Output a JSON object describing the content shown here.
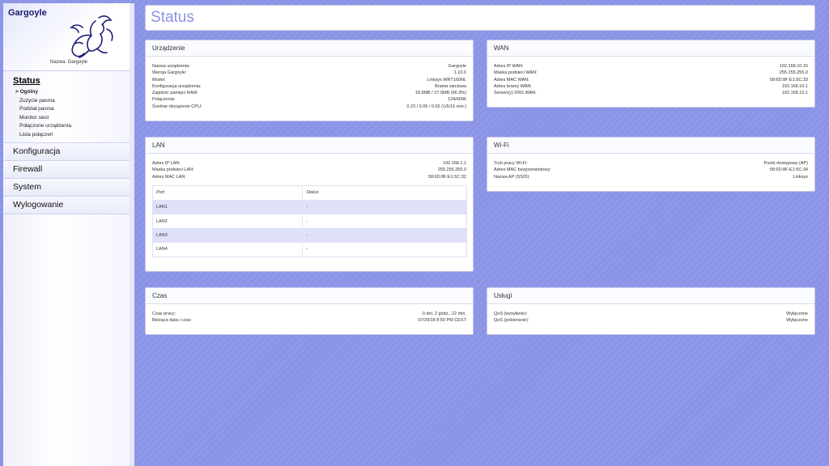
{
  "sidebar": {
    "title": "Gargoyle",
    "device_name": "Nazwa: Gargoyle",
    "current": {
      "label": "Status",
      "subitems": [
        "> Ogólny",
        "Zużycie pasma",
        "Podział pasma",
        "Monitor sieci",
        "Połączone urządzenia",
        "Lista połączeń"
      ]
    },
    "items": [
      "Konfiguracja",
      "Firewall",
      "System",
      "Wylogowanie"
    ]
  },
  "page_title": "Status",
  "device": {
    "title": "Urządzenie",
    "rows": [
      {
        "k": "Nazwa urządzenia:",
        "v": "Gargoyle"
      },
      {
        "k": "Wersja Gargoyle:",
        "v": "1.10.0"
      },
      {
        "k": "Model:",
        "v": "Linksys WRT160NL"
      },
      {
        "k": "Konfiguracja urządzenia:",
        "v": "Brama sieciowa"
      },
      {
        "k": "Zajętość pamięci RAM:",
        "v": "18.5MB / 27.9MB (66.3%)"
      },
      {
        "k": "Połączenia:",
        "v": "124/4096"
      },
      {
        "k": "Średnie obciążenie CPU:",
        "v": "0.23 / 0.05 / 0.02 (1/5/15 min.)"
      }
    ]
  },
  "wan": {
    "title": "WAN",
    "rows": [
      {
        "k": "Adres IP WAN:",
        "v": "192.168.10.15"
      },
      {
        "k": "Maska podsieci WAN:",
        "v": "255.255.255.0"
      },
      {
        "k": "Adres MAC WAN:",
        "v": "58:6D:8F:E1:5C:33"
      },
      {
        "k": "Adres bramy WAN:",
        "v": "192.168.10.1"
      },
      {
        "k": "Serwer(y) DNS WAN:",
        "v": "192.168.10.1"
      }
    ]
  },
  "lan": {
    "title": "LAN",
    "rows": [
      {
        "k": "Adres IP LAN:",
        "v": "192.168.1.1"
      },
      {
        "k": "Maska podsieci LAN:",
        "v": "255.255.255.0"
      },
      {
        "k": "Adres MAC LAN:",
        "v": "58:6D:8F:E1:5C:32"
      }
    ],
    "table": {
      "headers": [
        "Port",
        "Status"
      ],
      "rows": [
        [
          "LAN1",
          "-"
        ],
        [
          "LAN2",
          "-"
        ],
        [
          "LAN3",
          "-"
        ],
        [
          "LAN4",
          "-"
        ]
      ]
    }
  },
  "wifi": {
    "title": "Wi-Fi",
    "rows": [
      {
        "k": "Tryb pracy Wi-Fi:",
        "v": "Punkt dostępowy (AP)"
      },
      {
        "k": "Adres MAC bezprzewodowy:",
        "v": "58:6D:8F:E1:5C:34"
      },
      {
        "k": "Nazwa AP (SSID):",
        "v": "Linksys"
      }
    ]
  },
  "time": {
    "title": "Czas",
    "rows": [
      {
        "k": "Czas pracy:",
        "v": "0 dni, 2 godz., 22 min."
      },
      {
        "k": "Bieżąca data i czas:",
        "v": "07/20/18 8:50 PM CEST"
      }
    ]
  },
  "services": {
    "title": "Usługi",
    "rows": [
      {
        "k": "QoS (wysyłanie):",
        "v": "Wyłączone"
      },
      {
        "k": "QoS (pobieranie):",
        "v": "Wyłączone"
      }
    ]
  },
  "colors": {
    "background": "#8a93e6",
    "accent": "#8a93e6",
    "lan_row_alt": "#dfe1fa"
  },
  "icons": {
    "logo": "gargoyle-logo-icon"
  }
}
